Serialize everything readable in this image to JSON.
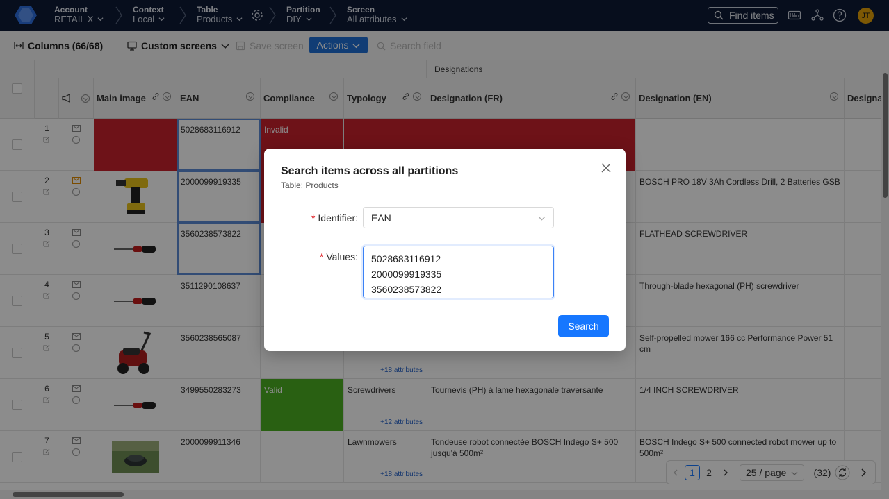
{
  "nav": {
    "account_key": "Account",
    "account_val": "RETAIL X",
    "context_key": "Context",
    "context_val": "Local",
    "table_key": "Table",
    "table_val": "Products",
    "partition_key": "Partition",
    "partition_val": "DIY",
    "screen_key": "Screen",
    "screen_val": "All attributes",
    "find_items": "Find items",
    "avatar_initials": "JT"
  },
  "toolbar": {
    "columns_label": "Columns (66/68)",
    "custom_screens_label": "Custom screens",
    "save_screen_label": "Save screen",
    "actions_label": "Actions",
    "search_field_placeholder": "Search field"
  },
  "grid": {
    "group_header": "Designations",
    "headers": {
      "main_image": "Main image",
      "ean": "EAN",
      "compliance": "Compliance",
      "typology": "Typology",
      "designation_fr": "Designation (FR)",
      "designation_en": "Designation (EN)",
      "designation_more": "Designat"
    },
    "rows": [
      {
        "num": "1",
        "ean": "5028683116912",
        "compliance": "Invalid",
        "typology": "",
        "des_fr": "",
        "des_en": "",
        "more": ""
      },
      {
        "num": "2",
        "ean": "2000099919335",
        "compliance": "",
        "typology": "",
        "des_fr": "",
        "des_en": "BOSCH PRO 18V 3Ah Cordless Drill, 2 Batteries GSB",
        "more": ""
      },
      {
        "num": "3",
        "ean": "3560238573822",
        "compliance": "",
        "typology": "",
        "des_fr": "",
        "des_en": "FLATHEAD SCREWDRIVER",
        "more": ""
      },
      {
        "num": "4",
        "ean": "3511290108637",
        "compliance": "",
        "typology": "",
        "des_fr": "",
        "des_en": "Through-blade hexagonal (PH) screwdriver",
        "more": ""
      },
      {
        "num": "5",
        "ean": "3560238565087",
        "compliance": "",
        "typology": "",
        "des_fr": "",
        "des_en": "Self-propelled mower 166 cc Performance Power 51 cm",
        "more": "+18 attributes"
      },
      {
        "num": "6",
        "ean": "3499550283273",
        "compliance": "Valid",
        "typology": "Screwdrivers",
        "des_fr": "Tournevis (PH) à lame hexagonale traversante",
        "des_en": "1/4 INCH SCREWDRIVER",
        "more": "+12 attributes"
      },
      {
        "num": "7",
        "ean": "2000099911346",
        "compliance": "",
        "typology": "Lawnmowers",
        "des_fr": "Tondeuse robot connectée BOSCH Indego S+ 500 jusqu'à 500m²",
        "des_en": "BOSCH Indego S+ 500 connected robot mower up to 500m²",
        "more": "+18 attributes"
      }
    ],
    "colors": {
      "invalid": "#c8212d",
      "valid": "#4caf22"
    }
  },
  "modal": {
    "title": "Search items across all partitions",
    "subtitle": "Table: Products",
    "identifier_label": "Identifier",
    "identifier_value": "EAN",
    "values_label": "Values",
    "values": [
      "5028683116912",
      "2000099919335",
      "3560238573822"
    ],
    "search_button": "Search"
  },
  "pager": {
    "page1": "1",
    "page2": "2",
    "page_size": "25 / page",
    "total": "(32)"
  }
}
